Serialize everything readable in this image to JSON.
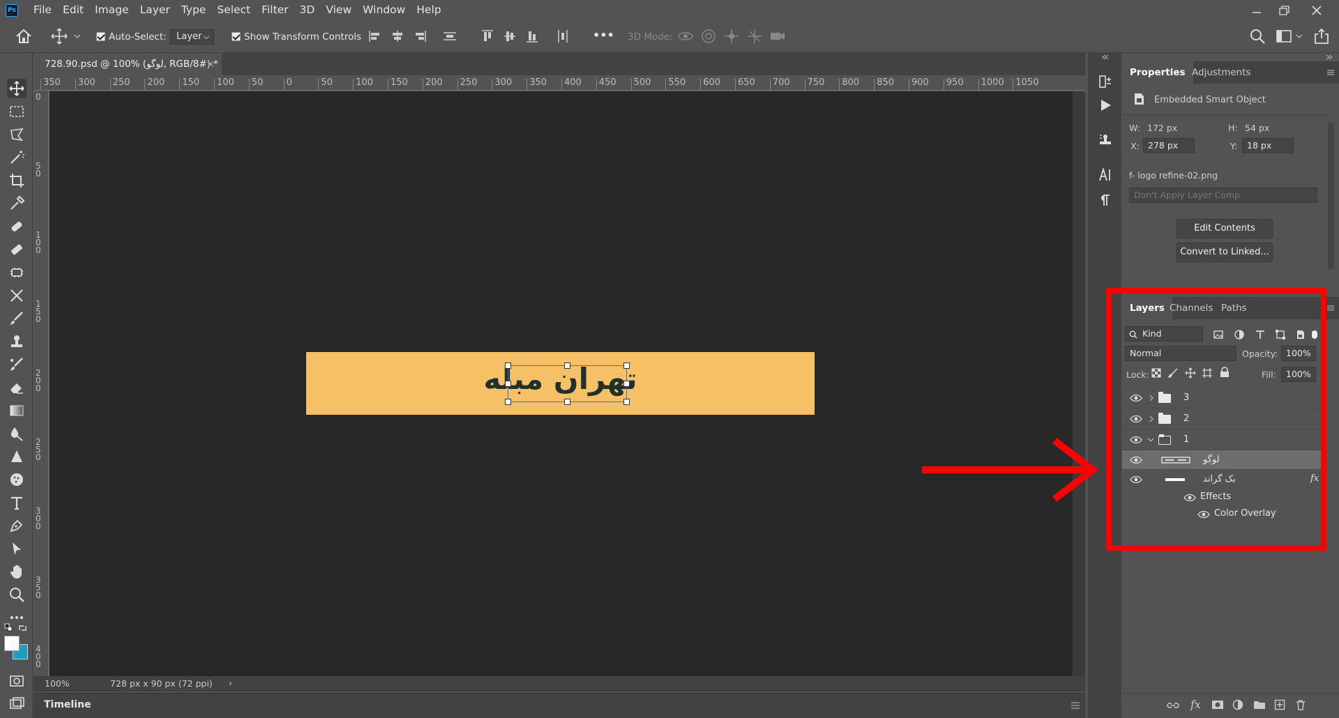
{
  "app": {
    "logo": "Ps"
  },
  "menu": [
    "File",
    "Edit",
    "Image",
    "Layer",
    "Type",
    "Select",
    "Filter",
    "3D",
    "View",
    "Window",
    "Help"
  ],
  "options": {
    "auto_select_label": "Auto-Select:",
    "auto_select_target": "Layer",
    "show_transform_label": "Show Transform Controls",
    "mode_3d_label": "3D Mode:",
    "more": "•••"
  },
  "document": {
    "tab_title": "728.90.psd @ 100% (لوگو, RGB/8#) *",
    "close": "×",
    "canvas_text": "تهران مبله",
    "canvas_color": "#f6c166",
    "ruler_h": [
      "350",
      "300",
      "250",
      "200",
      "150",
      "100",
      "50",
      "0",
      "50",
      "100",
      "150",
      "200",
      "250",
      "300",
      "350",
      "400",
      "450",
      "500",
      "550",
      "600",
      "650",
      "700",
      "750",
      "800",
      "850",
      "900",
      "950",
      "1000",
      "1050"
    ],
    "ruler_v": [
      "0",
      "50",
      "100",
      "150",
      "200",
      "250",
      "300",
      "350",
      "400"
    ]
  },
  "status": {
    "zoom": "100%",
    "dims": "728 px x 90 px (72 ppi)",
    "arrow": "›"
  },
  "timeline": {
    "label": "Timeline"
  },
  "properties": {
    "tabs": [
      "Properties",
      "Adjustments"
    ],
    "object_type": "Embedded Smart Object",
    "w_label": "W:",
    "w": "172 px",
    "h_label": "H:",
    "h": "54 px",
    "x_label": "X:",
    "x": "278 px",
    "y_label": "Y:",
    "y": "18 px",
    "file": "f- logo refine-02.png",
    "layer_comp": "Don't Apply Layer Comp",
    "edit_contents": "Edit Contents",
    "convert": "Convert to Linked..."
  },
  "layers": {
    "tabs": [
      "Layers",
      "Channels",
      "Paths"
    ],
    "kind": "Kind",
    "blend": "Normal",
    "opacity_label": "Opacity:",
    "opacity": "100%",
    "lock_label": "Lock:",
    "fill_label": "Fill:",
    "fill": "100%",
    "items": [
      {
        "name": "3"
      },
      {
        "name": "2"
      },
      {
        "name": "1"
      },
      {
        "name": "لوگو"
      },
      {
        "name": "بک گراند",
        "fx": "fx"
      },
      {
        "name": "Effects"
      },
      {
        "name": "Color Overlay"
      }
    ]
  },
  "annotation_color": "#ff0000"
}
